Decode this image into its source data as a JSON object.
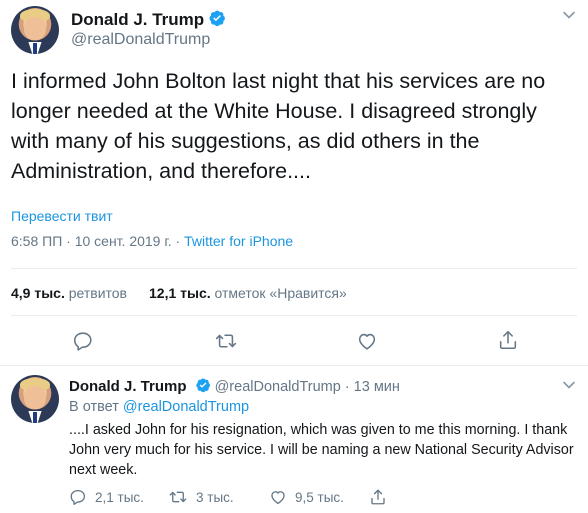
{
  "main_tweet": {
    "author_name": "Donald J. Trump",
    "handle": "@realDonaldTrump",
    "text": "I informed John Bolton last night that his services are no longer needed at the White House. I disagreed strongly with many of his suggestions, as did others in the Administration, and therefore....",
    "translate_label": "Перевести твит",
    "timestamp": "6:58 ПП · 10 сент. 2019 г.",
    "source_sep": " · ",
    "source": "Twitter for iPhone",
    "retweets_count": "4,9 тыс.",
    "retweets_label": "ретвитов",
    "likes_count": "12,1 тыс.",
    "likes_label": "отметок «Нравится»",
    "icons": [
      "reply-icon",
      "retweet-icon",
      "like-icon",
      "share-icon"
    ]
  },
  "reply_tweet": {
    "author_name": "Donald J. Trump",
    "handle": "@realDonaldTrump",
    "time_sep": " · ",
    "time_ago": "13 мин",
    "reply_prefix": "В ответ",
    "reply_mention": "@realDonaldTrump",
    "text": "....I asked John for his resignation, which was given to me this morning. I thank John very much for his service. I will be naming a new National Security Advisor next week.",
    "replies_count": "2,1 тыс.",
    "retweets_count": "3 тыс.",
    "likes_count": "9,5 тыс."
  },
  "colors": {
    "link": "#1b95e0",
    "secondary_text": "#657786",
    "primary_text": "#14171a",
    "divider": "#e6ecf0",
    "verified": "#1da1f2"
  }
}
